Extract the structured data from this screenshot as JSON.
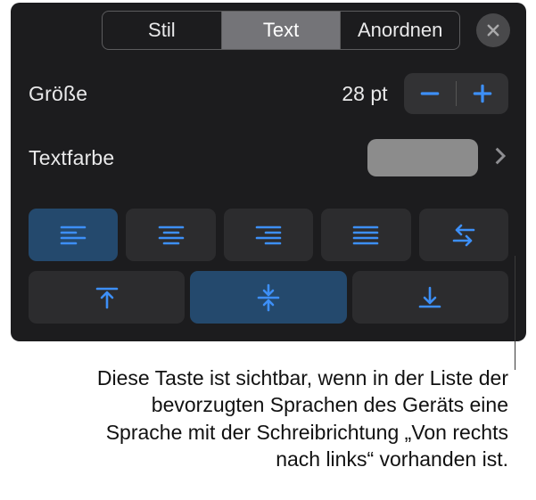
{
  "tabs": {
    "stil": "Stil",
    "text": "Text",
    "anordnen": "Anordnen"
  },
  "size": {
    "label": "Größe",
    "value": "28 pt"
  },
  "textColor": {
    "label": "Textfarbe",
    "swatchColor": "#8c8c8c"
  },
  "icons": {
    "close": "close-icon",
    "minus": "minus-icon",
    "plus": "plus-icon",
    "chevron": "chevron-right-icon",
    "alignLeft": "align-left-icon",
    "alignCenter": "align-center-icon",
    "alignRight": "align-right-icon",
    "alignJustify": "align-justify-icon",
    "bidi": "rtl-direction-icon",
    "valignTop": "valign-top-icon",
    "valignMiddle": "valign-middle-icon",
    "valignBottom": "valign-bottom-icon"
  },
  "caption": "Diese Taste ist sichtbar, wenn in der Liste der bevorzugten Sprachen des Geräts eine Sprache mit der Schreibrichtung „Von rechts nach links“ vorhanden ist."
}
